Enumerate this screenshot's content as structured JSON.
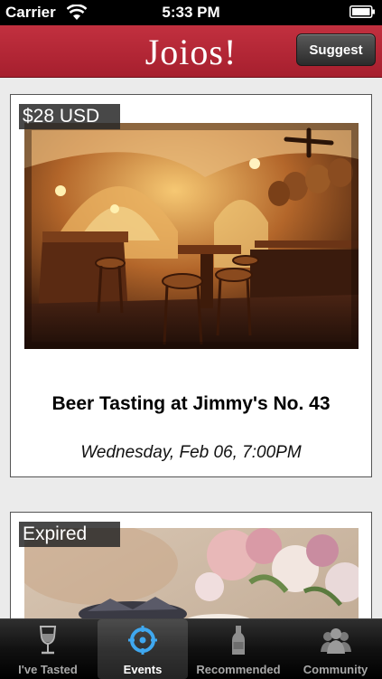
{
  "status_bar": {
    "carrier": "Carrier",
    "time": "5:33 PM"
  },
  "nav": {
    "title": "Joios!",
    "suggest_label": "Suggest"
  },
  "events": [
    {
      "price": "$28 USD",
      "title": "Beer Tasting at Jimmy's No. 43",
      "date": "Wednesday, Feb 06, 7:00PM"
    },
    {
      "price": "Expired"
    }
  ],
  "tabs": [
    {
      "label": "I've Tasted",
      "icon": "wine-glass-icon"
    },
    {
      "label": "Events",
      "icon": "crosshair-icon"
    },
    {
      "label": "Recommended",
      "icon": "bottle-icon"
    },
    {
      "label": "Community",
      "icon": "people-icon"
    }
  ],
  "colors": {
    "nav_red": "#b32736",
    "active_tab_blue": "#3fa8f0"
  }
}
